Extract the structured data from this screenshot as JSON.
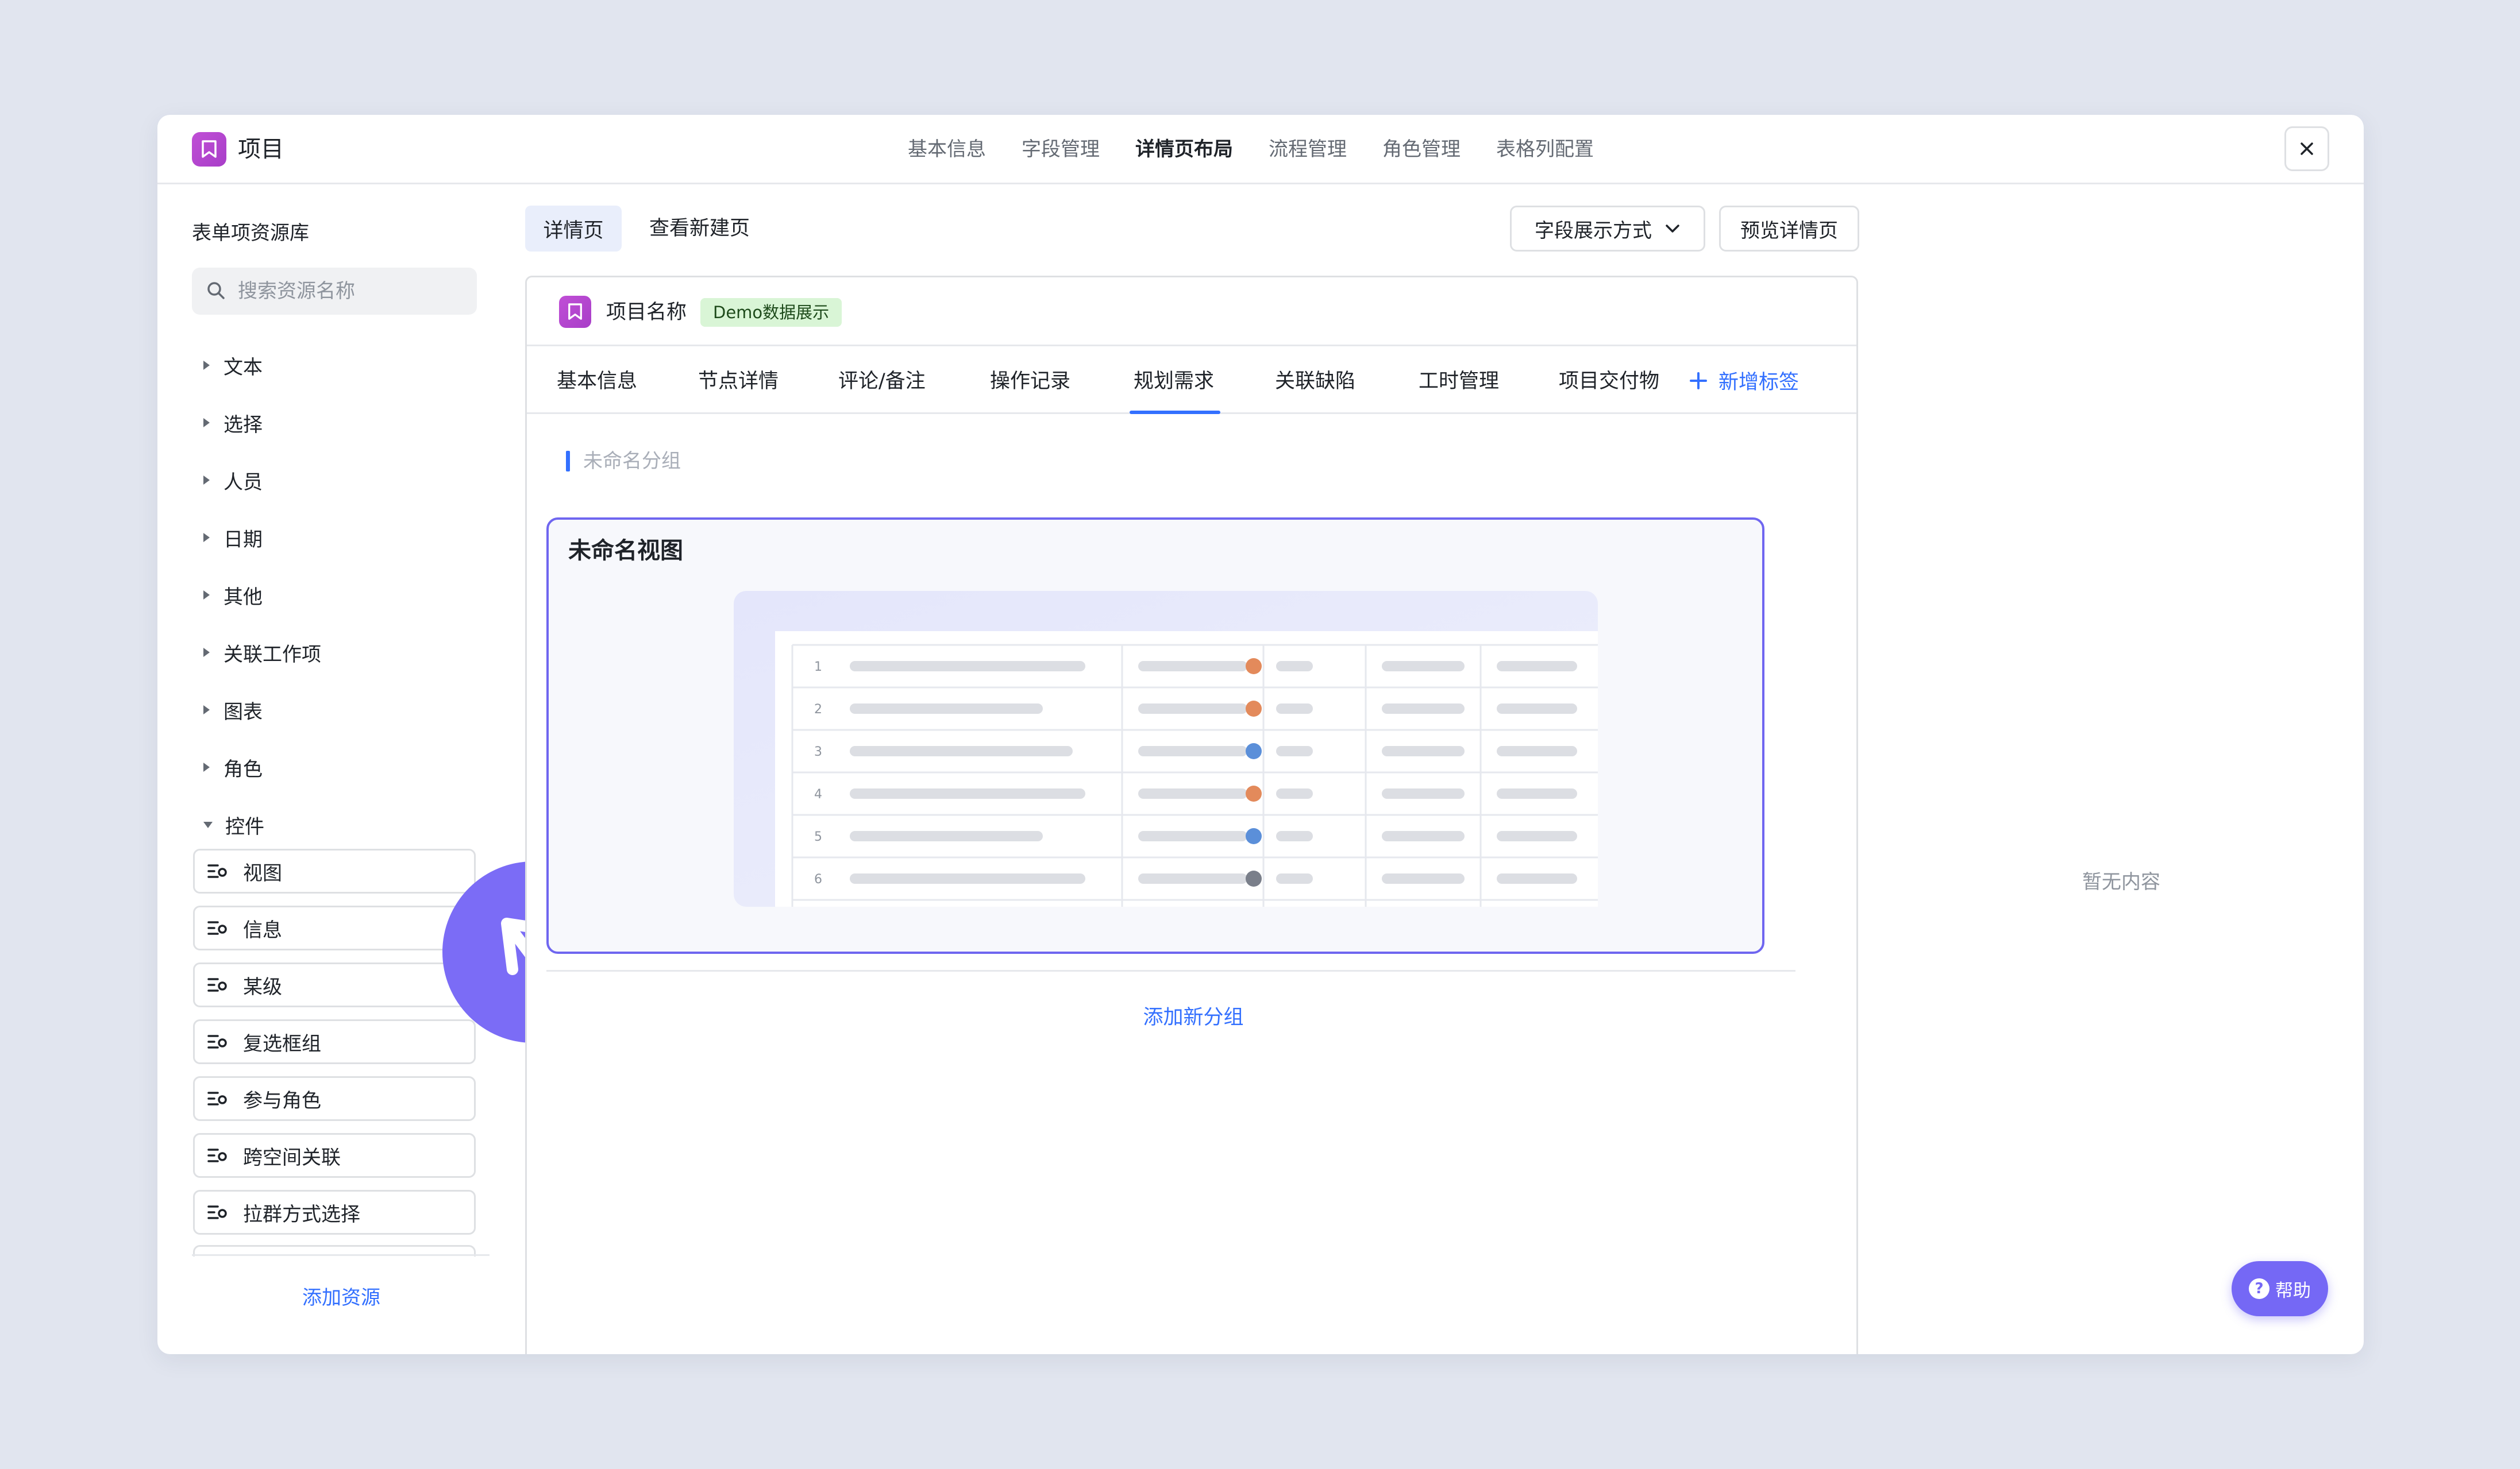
{
  "header": {
    "app_title": "项目",
    "tabs": [
      {
        "label": "基本信息"
      },
      {
        "label": "字段管理"
      },
      {
        "label": "详情页布局"
      },
      {
        "label": "流程管理"
      },
      {
        "label": "角色管理"
      },
      {
        "label": "表格列配置"
      }
    ],
    "active_tab": "详情页布局",
    "close_icon": "close-icon"
  },
  "left_panel": {
    "title": "表单项资源库",
    "search_placeholder": "搜索资源名称",
    "categories": [
      {
        "label": "文本"
      },
      {
        "label": "选择"
      },
      {
        "label": "人员"
      },
      {
        "label": "日期"
      },
      {
        "label": "其他"
      },
      {
        "label": "关联工作项"
      },
      {
        "label": "图表"
      },
      {
        "label": "角色"
      },
      {
        "label": "控件"
      }
    ],
    "expanded_category": "控件",
    "controls": [
      {
        "label": "视图"
      },
      {
        "label": "信息"
      },
      {
        "label": "某级"
      },
      {
        "label": "复选框组"
      },
      {
        "label": "参与角色"
      },
      {
        "label": "跨空间关联"
      },
      {
        "label": "拉群方式选择"
      }
    ],
    "add_resource": "添加资源"
  },
  "toolbar": {
    "subtabs": [
      {
        "label": "详情页"
      },
      {
        "label": "查看新建页"
      }
    ],
    "active_subtab": "详情页",
    "field_display_label": "字段展示方式",
    "preview_label": "预览详情页"
  },
  "detail": {
    "project_name": "项目名称",
    "demo_badge": "Demo数据展示",
    "tabs": [
      {
        "label": "基本信息"
      },
      {
        "label": "节点详情"
      },
      {
        "label": "评论/备注"
      },
      {
        "label": "操作记录"
      },
      {
        "label": "规划需求"
      },
      {
        "label": "关联缺陷"
      },
      {
        "label": "工时管理"
      },
      {
        "label": "项目交付物"
      }
    ],
    "active_tab": "规划需求",
    "add_tab_label": "新增标签",
    "group_name": "未命名分组",
    "view_title": "未命名视图",
    "preview_rows": [
      "1",
      "2",
      "3",
      "4",
      "5",
      "6"
    ],
    "add_group_label": "添加新分组"
  },
  "right_panel": {
    "empty_text": "暂无内容"
  },
  "help": {
    "label": "帮助"
  },
  "colors": {
    "accent": "#3370ff",
    "view_border": "#6f66f0",
    "help_bg": "#7568f5",
    "brand_icon": "#b547d0",
    "demo_badge_bg": "#d9f5d6"
  }
}
